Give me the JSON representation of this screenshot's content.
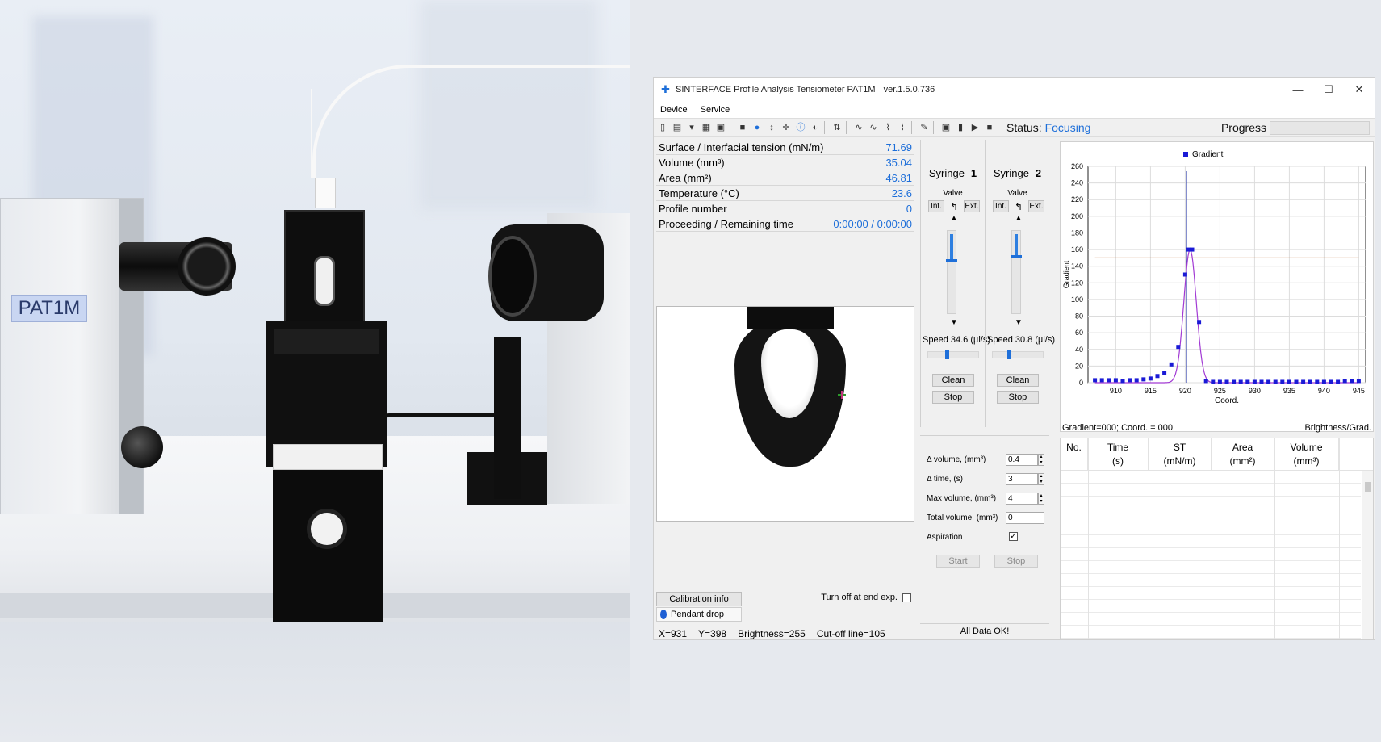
{
  "photo": {
    "device_label": "PAT1M"
  },
  "window": {
    "title": "SINTERFACE Profile Analysis Tensiometer PAT1M",
    "version": "ver.1.5.0.736",
    "controls": {
      "minimize": "—",
      "maximize": "☐",
      "close": "✕"
    }
  },
  "menu": [
    "Device",
    "Service"
  ],
  "toolbar": {
    "status_label": "Status:",
    "status_value": "Focusing",
    "progress_label": "Progress"
  },
  "measurements": [
    {
      "label": "Surface / Interfacial tension (mN/m)",
      "value": "71.69"
    },
    {
      "label": "Volume (mm³)",
      "value": "35.04"
    },
    {
      "label": "Area (mm²)",
      "value": "46.81"
    },
    {
      "label": "Temperature (°C)",
      "value": "23.6"
    },
    {
      "label": "Profile number",
      "value": "0"
    },
    {
      "label": "Proceeding / Remaining time",
      "value": "0:00:00 / 0:00:00"
    }
  ],
  "bottom_left": {
    "calibration_button": "Calibration info",
    "mode": "Pendant drop",
    "turn_off_label": "Turn off at end exp."
  },
  "status_bar": {
    "x": "X=931",
    "y": "Y=398",
    "brightness": "Brightness=255",
    "cutoff": "Cut-off line=105"
  },
  "syringes": [
    {
      "label": "Syringe",
      "number": "1",
      "valve_label": "Valve",
      "int": "Int.",
      "ext": "Ext.",
      "speed_text": "Speed  34.6 (µl/s)",
      "level": 0.6,
      "speed_level": 0.35,
      "clean": "Clean",
      "stop": "Stop"
    },
    {
      "label": "Syringe",
      "number": "2",
      "valve_label": "Valve",
      "int": "Int.",
      "ext": "Ext.",
      "speed_text": "Speed  30.8 (µl/s)",
      "level": 0.5,
      "speed_level": 0.3,
      "clean": "Clean",
      "stop": "Stop"
    }
  ],
  "dosing": {
    "fields": [
      {
        "label": "Δ volume,  (mm³)",
        "value": "0.4"
      },
      {
        "label": "Δ time,  (s)",
        "value": "3"
      },
      {
        "label": "Max volume,  (mm³)",
        "value": "4"
      },
      {
        "label": "Total volume,  (mm³)",
        "value": "0"
      }
    ],
    "aspiration_label": "Aspiration",
    "aspiration_checked": "✓",
    "start": "Start",
    "stop": "Stop",
    "all_data": "All Data OK!"
  },
  "chart_data": {
    "type": "scatter",
    "legend": "Gradient",
    "legend_position": "top-center",
    "xlabel": "Coord.",
    "ylabel": "Gradient",
    "xlim": [
      906,
      946
    ],
    "ylim": [
      0,
      260
    ],
    "x_ticks": [
      910,
      915,
      920,
      925,
      930,
      935,
      940,
      945
    ],
    "y_ticks": [
      0,
      20,
      40,
      60,
      80,
      100,
      120,
      140,
      160,
      180,
      200,
      220,
      240,
      260
    ],
    "grid": true,
    "series": [
      {
        "name": "Gradient",
        "color": "#1a1ad6",
        "points": [
          [
            907,
            3
          ],
          [
            908,
            3
          ],
          [
            909,
            3
          ],
          [
            910,
            3
          ],
          [
            911,
            2
          ],
          [
            912,
            3
          ],
          [
            913,
            3
          ],
          [
            914,
            4
          ],
          [
            915,
            5
          ],
          [
            916,
            8
          ],
          [
            917,
            12
          ],
          [
            918,
            22
          ],
          [
            919,
            43
          ],
          [
            920,
            130
          ],
          [
            920.5,
            160
          ],
          [
            921,
            160
          ],
          [
            922,
            73
          ],
          [
            923,
            2
          ],
          [
            924,
            1
          ],
          [
            925,
            1
          ],
          [
            926,
            1
          ],
          [
            927,
            1
          ],
          [
            928,
            1
          ],
          [
            929,
            1
          ],
          [
            930,
            1
          ],
          [
            931,
            1
          ],
          [
            932,
            1
          ],
          [
            933,
            1
          ],
          [
            934,
            1
          ],
          [
            935,
            1
          ],
          [
            936,
            1
          ],
          [
            937,
            1
          ],
          [
            938,
            1
          ],
          [
            939,
            1
          ],
          [
            940,
            1
          ],
          [
            941,
            1
          ],
          [
            942,
            1
          ],
          [
            943,
            2
          ],
          [
            944,
            2
          ],
          [
            945,
            2
          ]
        ]
      }
    ],
    "fit_curve_color": "#a23ad4",
    "threshold_line": {
      "y": 150,
      "color": "#c0703a"
    },
    "cursor_line": {
      "x": 920.2,
      "color": "#3a4ab0"
    },
    "footer_left": "Gradient=000; Coord. = 000",
    "footer_right": "Brightness/Grad."
  },
  "results_table": {
    "columns": [
      {
        "top": "No.",
        "bottom": ""
      },
      {
        "top": "Time",
        "bottom": "(s)"
      },
      {
        "top": "ST",
        "bottom": "(mN/m)"
      },
      {
        "top": "Area",
        "bottom": "(mm²)"
      },
      {
        "top": "Volume",
        "bottom": "(mm³)"
      }
    ]
  }
}
